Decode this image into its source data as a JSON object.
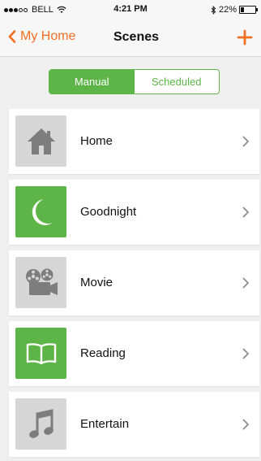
{
  "status_bar": {
    "carrier": "BELL",
    "time": "4:21 PM",
    "battery_percent": "22%",
    "battery_level": 0.22,
    "signal_bars_filled": 3,
    "signal_bars_total": 5
  },
  "nav": {
    "back_label": "My Home",
    "title": "Scenes",
    "add_icon": "plus-icon",
    "accent_color": "#f26f22"
  },
  "segments": {
    "manual_label": "Manual",
    "scheduled_label": "Scheduled",
    "selected": "Manual",
    "active_color": "#5db548"
  },
  "scenes": [
    {
      "label": "Home",
      "icon": "house-icon",
      "tile_color": "#d6d6d6",
      "active": false
    },
    {
      "label": "Goodnight",
      "icon": "moon-icon",
      "tile_color": "#5db548",
      "active": true
    },
    {
      "label": "Movie",
      "icon": "film-projector-icon",
      "tile_color": "#d6d6d6",
      "active": false
    },
    {
      "label": "Reading",
      "icon": "book-icon",
      "tile_color": "#5db548",
      "active": true
    },
    {
      "label": "Entertain",
      "icon": "music-note-icon",
      "tile_color": "#d6d6d6",
      "active": false
    }
  ]
}
